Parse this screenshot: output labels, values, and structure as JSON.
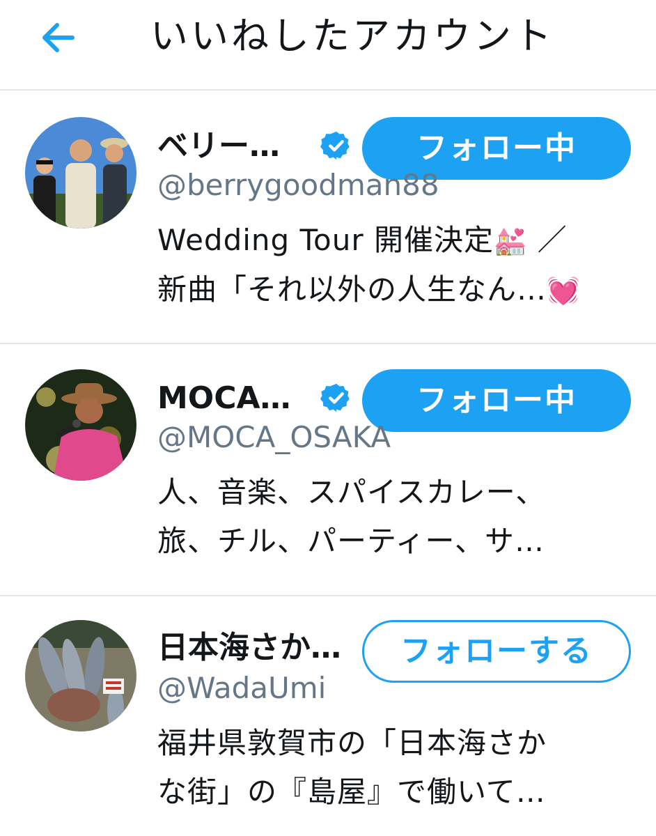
{
  "header": {
    "back_icon": "arrow-left-icon",
    "title": "いいねしたアカウント"
  },
  "colors": {
    "accent": "#1da1f2",
    "handle": "#657786",
    "divider": "#e1e8ed",
    "text": "#14171a"
  },
  "accounts": [
    {
      "name": "ベリー…",
      "verified": true,
      "handle": "@berrygoodman88",
      "bio_line1": "Wedding Tour 開催決定",
      "bio_line1_emoji": "💒",
      "bio_line1_tail": "／",
      "bio_line2": "新曲「それ以外の人生なん…",
      "bio_line2_emoji": "💓",
      "button": "フォロー中"
    },
    {
      "name": "MOCA…",
      "verified": true,
      "handle": "@MOCA_OSAKA",
      "bio_line1": "人、音楽、スパイスカレー、",
      "bio_line2": "旅、チル、パーティー、サ…",
      "button": "フォロー中"
    },
    {
      "name": "日本海さか…",
      "verified": false,
      "handle": "@WadaUmi",
      "bio_line1": "福井県敦賀市の「日本海さか",
      "bio_line2": "な街」の『島屋』で働いて…",
      "button": "フォローする"
    }
  ]
}
